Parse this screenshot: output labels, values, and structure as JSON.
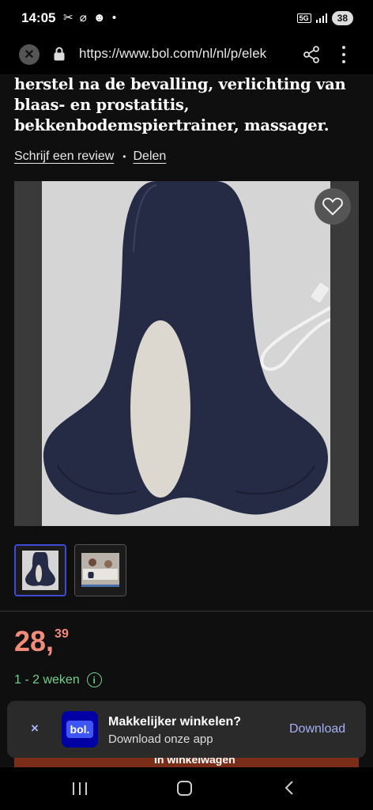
{
  "status_bar": {
    "time": "14:05",
    "left_icons": "✂ ⌀ ☻ •",
    "network": "5G",
    "battery": "38"
  },
  "browser": {
    "url": "https://www.bol.com/nl/nl/p/elek"
  },
  "product": {
    "title": "herstel na de bevalling, verlichting van blaas- en prostatitis, bekkenbodemspiertrainer, massager.",
    "review_link": "Schrijf een review",
    "separator": "•",
    "share_link": "Delen",
    "price_whole": "28,",
    "price_cents": "39",
    "delivery": "1 - 2 weken"
  },
  "app_banner": {
    "close": "×",
    "logo_text": "bol.",
    "title": "Makkelijker winkelen?",
    "subtitle": "Download onze app",
    "cta": "Download"
  },
  "cart_button": {
    "label": "In winkelwagen"
  },
  "colors": {
    "price": "#f28b79",
    "delivery": "#6fd08a",
    "accent": "#a7aff5",
    "brand": "#0000a4"
  }
}
